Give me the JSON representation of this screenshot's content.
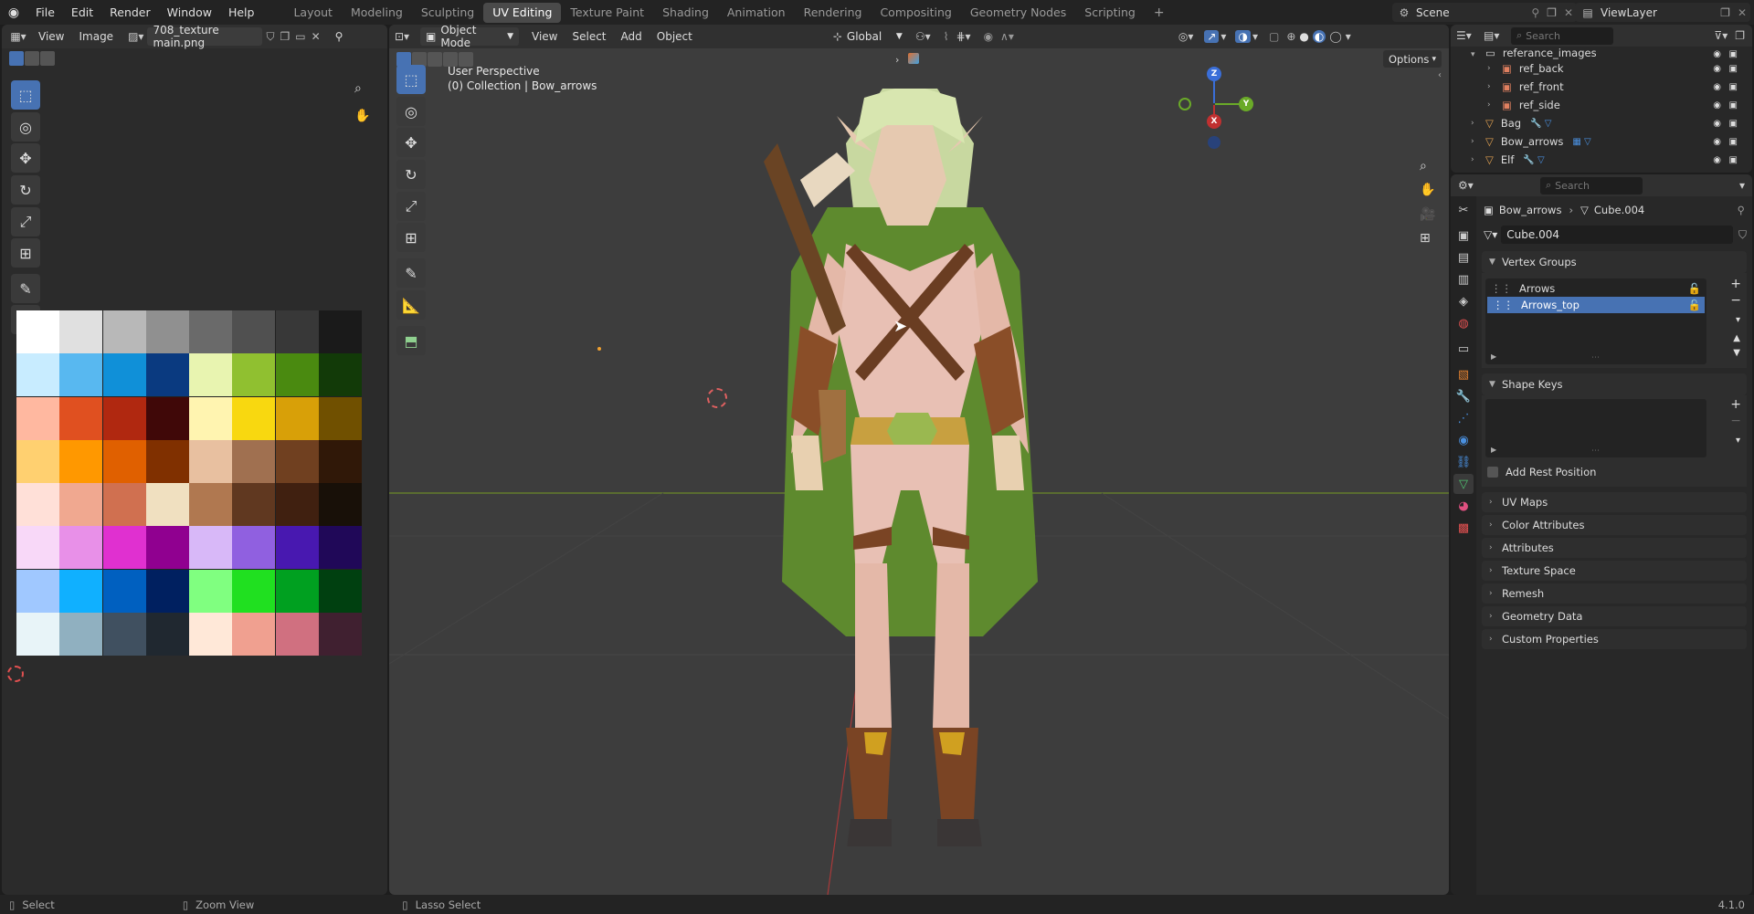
{
  "topbar": {
    "menus": [
      "File",
      "Edit",
      "Render",
      "Window",
      "Help"
    ],
    "workspaces": [
      "Layout",
      "Modeling",
      "Sculpting",
      "UV Editing",
      "Texture Paint",
      "Shading",
      "Animation",
      "Rendering",
      "Compositing",
      "Geometry Nodes",
      "Scripting"
    ],
    "active_workspace": "UV Editing",
    "scene_label": "Scene",
    "viewlayer_label": "ViewLayer"
  },
  "image_editor": {
    "menus": [
      "View",
      "Image"
    ],
    "image_name": "708_texture main.png"
  },
  "viewport": {
    "mode": "Object Mode",
    "menus": [
      "View",
      "Select",
      "Add",
      "Object"
    ],
    "transform_orientation": "Global",
    "options_label": "Options",
    "overlay_line1": "User Perspective",
    "overlay_line2": "(0) Collection | Bow_arrows",
    "gizmo": {
      "z": "Z",
      "y": "Y",
      "x": "X"
    }
  },
  "outliner": {
    "search_placeholder": "Search",
    "items": [
      {
        "name": "referance_images",
        "indent": 1
      },
      {
        "name": "ref_back",
        "indent": 2
      },
      {
        "name": "ref_front",
        "indent": 2
      },
      {
        "name": "ref_side",
        "indent": 2
      },
      {
        "name": "Bag",
        "indent": 1
      },
      {
        "name": "Bow_arrows",
        "indent": 1
      },
      {
        "name": "Elf",
        "indent": 1
      }
    ]
  },
  "properties": {
    "search_placeholder": "Search",
    "breadcrumb_object": "Bow_arrows",
    "breadcrumb_data": "Cube.004",
    "mesh_name": "Cube.004",
    "vertex_groups_title": "Vertex Groups",
    "vertex_groups": [
      "Arrows",
      "Arrows_top"
    ],
    "selected_vertex_group": "Arrows_top",
    "shape_keys_title": "Shape Keys",
    "add_rest_position": "Add Rest Position",
    "collapsed_panels": [
      "UV Maps",
      "Color Attributes",
      "Attributes",
      "Texture Space",
      "Remesh",
      "Geometry Data",
      "Custom Properties"
    ]
  },
  "status_bar": {
    "select": "Select",
    "zoom_view": "Zoom View",
    "lasso_select": "Lasso Select",
    "version": "4.1.0"
  },
  "colors": {
    "accent": "#4772b3",
    "background": "#1d1d1d",
    "viewport_bg": "#3d3d3d"
  }
}
